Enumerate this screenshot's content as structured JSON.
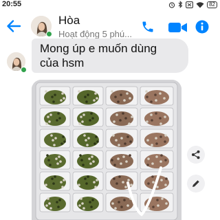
{
  "status_bar": {
    "time": "20:55",
    "battery": "82",
    "icons": [
      "alarm-icon",
      "bluetooth-icon",
      "sim-icon",
      "wifi-icon",
      "battery-icon"
    ]
  },
  "header": {
    "contact_name": "Hòa",
    "contact_status": "Hoạt động 5 phú...",
    "icons": [
      "back-arrow-icon",
      "phone-icon",
      "video-camera-icon",
      "info-icon"
    ]
  },
  "conversation": {
    "message_lines": [
      "Mong úp e muốn dùng",
      "của hsm"
    ],
    "attachment": "photo"
  },
  "actions": [
    "share-icon",
    "edit-icon"
  ],
  "colors": {
    "accent": "#0084ff",
    "online": "#31a24c",
    "bubble": "#e9e9eb"
  }
}
